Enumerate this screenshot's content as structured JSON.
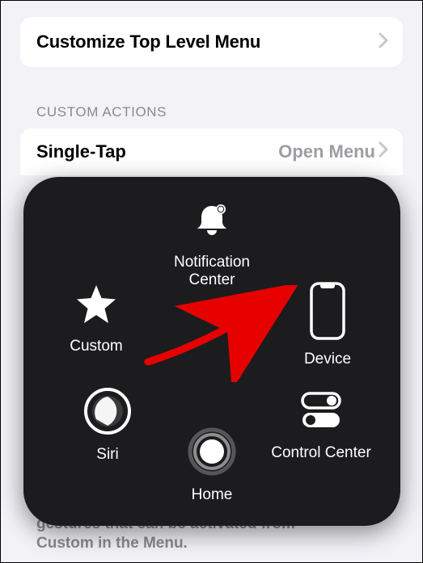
{
  "menu_row": {
    "title": "Customize Top Level Menu"
  },
  "section": {
    "header": "CUSTOM ACTIONS"
  },
  "single_tap": {
    "label": "Single-Tap",
    "value": "Open Menu"
  },
  "assistive_menu": {
    "notification": "Notification Center",
    "custom": "Custom",
    "device": "Device",
    "siri": "Siri",
    "home": "Home",
    "control": "Control Center"
  },
  "footer": {
    "line1": "gestures that can be activated from",
    "line2": "Custom in the Menu."
  }
}
